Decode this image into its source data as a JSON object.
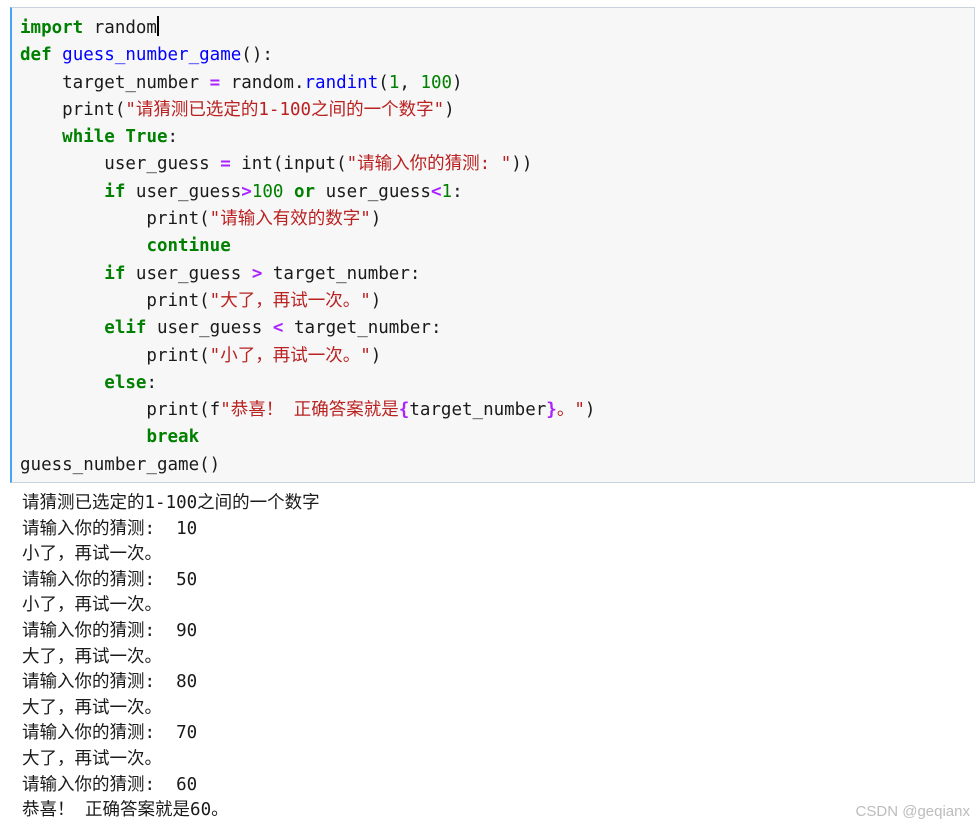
{
  "code_cell": {
    "lines": [
      [
        {
          "t": "import",
          "c": "kw"
        },
        {
          "t": " random",
          "c": "bi"
        }
      ],
      [
        {
          "t": "def",
          "c": "kw"
        },
        {
          "t": " ",
          "c": "bi"
        },
        {
          "t": "guess_number_game",
          "c": "fn"
        },
        {
          "t": "():",
          "c": "bi"
        }
      ],
      [
        {
          "t": "    target_number ",
          "c": "bi"
        },
        {
          "t": "=",
          "c": "op"
        },
        {
          "t": " random.",
          "c": "bi"
        },
        {
          "t": "randint",
          "c": "fn"
        },
        {
          "t": "(",
          "c": "bi"
        },
        {
          "t": "1",
          "c": "num"
        },
        {
          "t": ", ",
          "c": "bi"
        },
        {
          "t": "100",
          "c": "num"
        },
        {
          "t": ")",
          "c": "bi"
        }
      ],
      [
        {
          "t": "    print(",
          "c": "bi"
        },
        {
          "t": "\"请猜测已选定的1-100之间的一个数字\"",
          "c": "str"
        },
        {
          "t": ")",
          "c": "bi"
        }
      ],
      [
        {
          "t": "    ",
          "c": "bi"
        },
        {
          "t": "while",
          "c": "kw"
        },
        {
          "t": " ",
          "c": "bi"
        },
        {
          "t": "True",
          "c": "kw"
        },
        {
          "t": ":",
          "c": "bi"
        }
      ],
      [
        {
          "t": "        user_guess ",
          "c": "bi"
        },
        {
          "t": "=",
          "c": "op"
        },
        {
          "t": " int(input(",
          "c": "bi"
        },
        {
          "t": "\"请输入你的猜测: \"",
          "c": "str"
        },
        {
          "t": "))",
          "c": "bi"
        }
      ],
      [
        {
          "t": "        ",
          "c": "bi"
        },
        {
          "t": "if",
          "c": "kw"
        },
        {
          "t": " user_guess",
          "c": "bi"
        },
        {
          "t": ">",
          "c": "op"
        },
        {
          "t": "100",
          "c": "num"
        },
        {
          "t": " ",
          "c": "bi"
        },
        {
          "t": "or",
          "c": "kw"
        },
        {
          "t": " user_guess",
          "c": "bi"
        },
        {
          "t": "<",
          "c": "op"
        },
        {
          "t": "1",
          "c": "num"
        },
        {
          "t": ":",
          "c": "bi"
        }
      ],
      [
        {
          "t": "            print(",
          "c": "bi"
        },
        {
          "t": "\"请输入有效的数字\"",
          "c": "str"
        },
        {
          "t": ")",
          "c": "bi"
        }
      ],
      [
        {
          "t": "            ",
          "c": "bi"
        },
        {
          "t": "continue",
          "c": "kw"
        }
      ],
      [
        {
          "t": "        ",
          "c": "bi"
        },
        {
          "t": "if",
          "c": "kw"
        },
        {
          "t": " user_guess ",
          "c": "bi"
        },
        {
          "t": ">",
          "c": "op"
        },
        {
          "t": " target_number:",
          "c": "bi"
        }
      ],
      [
        {
          "t": "            print(",
          "c": "bi"
        },
        {
          "t": "\"大了，再试一次。\"",
          "c": "str"
        },
        {
          "t": ")",
          "c": "bi"
        }
      ],
      [
        {
          "t": "        ",
          "c": "bi"
        },
        {
          "t": "elif",
          "c": "kw"
        },
        {
          "t": " user_guess ",
          "c": "bi"
        },
        {
          "t": "<",
          "c": "op"
        },
        {
          "t": " target_number:",
          "c": "bi"
        }
      ],
      [
        {
          "t": "            print(",
          "c": "bi"
        },
        {
          "t": "\"小了，再试一次。\"",
          "c": "str"
        },
        {
          "t": ")",
          "c": "bi"
        }
      ],
      [
        {
          "t": "        ",
          "c": "bi"
        },
        {
          "t": "else",
          "c": "kw"
        },
        {
          "t": ":",
          "c": "bi"
        }
      ],
      [
        {
          "t": "            print(f",
          "c": "bi"
        },
        {
          "t": "\"恭喜！ 正确答案就是",
          "c": "str"
        },
        {
          "t": "{",
          "c": "op"
        },
        {
          "t": "target_number",
          "c": "bi"
        },
        {
          "t": "}",
          "c": "op"
        },
        {
          "t": "。\"",
          "c": "str"
        },
        {
          "t": ")",
          "c": "bi"
        }
      ],
      [
        {
          "t": "            ",
          "c": "bi"
        },
        {
          "t": "break",
          "c": "kw"
        }
      ],
      [
        {
          "t": "guess_number_game()",
          "c": "bi"
        }
      ]
    ]
  },
  "output": {
    "lines": [
      "请猜测已选定的1-100之间的一个数字",
      "请输入你的猜测:  10",
      "小了，再试一次。",
      "请输入你的猜测:  50",
      "小了，再试一次。",
      "请输入你的猜测:  90",
      "大了，再试一次。",
      "请输入你的猜测:  80",
      "大了，再试一次。",
      "请输入你的猜测:  70",
      "大了，再试一次。",
      "请输入你的猜测:  60",
      "恭喜！ 正确答案就是60。"
    ]
  },
  "watermark": "CSDN @geqianx",
  "colors": {
    "keyword": "#008000",
    "function": "#0000ff",
    "operator": "#aa22ff",
    "string": "#ba2121",
    "cell_border_active": "#42a5f5"
  }
}
